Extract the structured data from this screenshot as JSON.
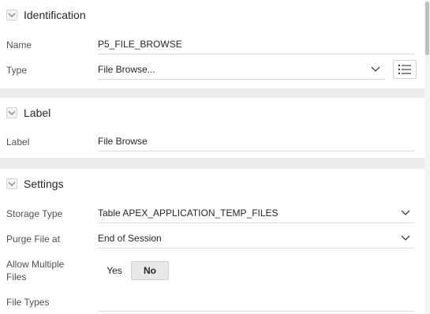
{
  "sections": {
    "identification": {
      "title": "Identification",
      "name_label": "Name",
      "name_value": "P5_FILE_BROWSE",
      "type_label": "Type",
      "type_value": "File Browse..."
    },
    "label": {
      "title": "Label",
      "label_label": "Label",
      "label_value": "File Browse"
    },
    "settings": {
      "title": "Settings",
      "storage_type_label": "Storage Type",
      "storage_type_value": "Table APEX_APPLICATION_TEMP_FILES",
      "purge_file_label": "Purge File at",
      "purge_file_value": "End of Session",
      "allow_multiple_label_line1": "Allow Multiple",
      "allow_multiple_label_line2": "Files",
      "allow_multiple_yes": "Yes",
      "allow_multiple_no": "No",
      "allow_multiple_selected": "No",
      "file_types_label": "File Types",
      "file_types_value": ""
    }
  },
  "icons": {
    "collapse": "chevron-down-icon",
    "select_caret": "chevron-down-icon",
    "list": "list-icon"
  },
  "colors": {
    "band": "#ececec",
    "toggle_selected": "#e8e8e8"
  }
}
